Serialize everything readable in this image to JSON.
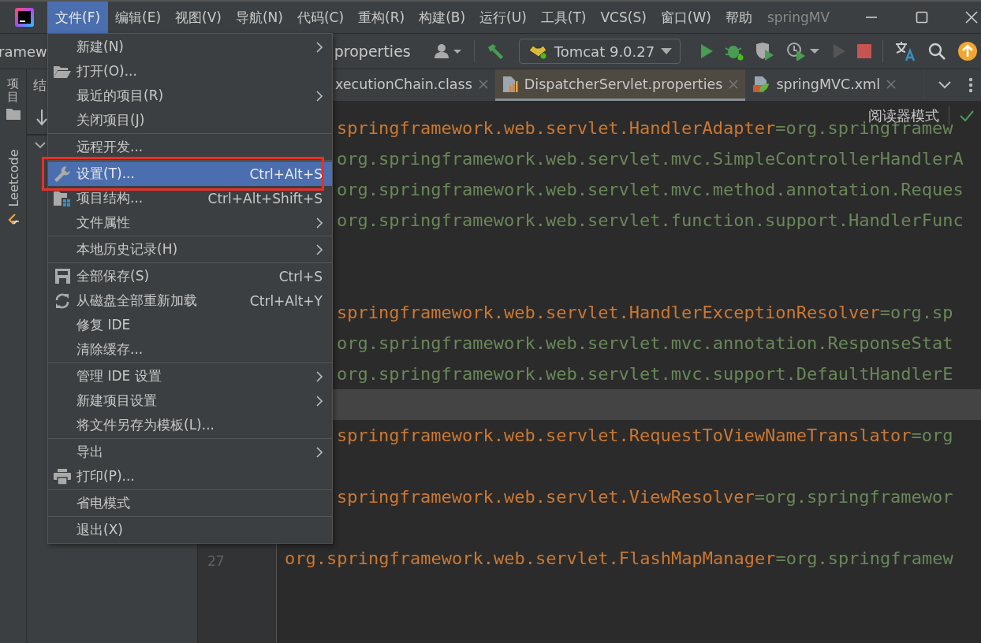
{
  "menu_bar": {
    "items": [
      {
        "label": "文件(F)",
        "selected": true
      },
      {
        "label": "编辑(E)",
        "selected": false
      },
      {
        "label": "视图(V)",
        "selected": false
      },
      {
        "label": "导航(N)",
        "selected": false
      },
      {
        "label": "代码(C)",
        "selected": false
      },
      {
        "label": "重构(R)",
        "selected": false
      },
      {
        "label": "构建(B)",
        "selected": false
      },
      {
        "label": "运行(U)",
        "selected": false
      },
      {
        "label": "工具(T)",
        "selected": false
      },
      {
        "label": "VCS(S)",
        "selected": false
      },
      {
        "label": "窗口(W)",
        "selected": false
      },
      {
        "label": "帮助",
        "selected": false
      }
    ],
    "window_title": "springMV"
  },
  "toolbar": {
    "breadcrumb": "ramew",
    "file": "properties",
    "run_config": "Tomcat 9.0.27"
  },
  "side_tabs": [
    {
      "label": "项目",
      "kind": "stacked"
    },
    {
      "label": "Leetcode",
      "kind": "rotated"
    }
  ],
  "project_panel": {
    "title": "结"
  },
  "editor_tabs": [
    {
      "label": "xecutionChain.class",
      "kind": "class",
      "selected": false
    },
    {
      "label": "DispatcherServlet.properties",
      "kind": "properties",
      "selected": true
    },
    {
      "label": "springMVC.xml",
      "kind": "xml",
      "selected": false
    }
  ],
  "editor": {
    "reader_mode": "阅读器模式",
    "lines": [
      {
        "kind": "entry",
        "key": "springframework.web.servlet.HandlerAdapter",
        "value": "=org.springframew",
        "current": false
      },
      {
        "kind": "continuation",
        "value": "org.springframework.web.servlet.mvc.SimpleControllerHandlerA",
        "current": false
      },
      {
        "kind": "continuation",
        "value": "org.springframework.web.servlet.mvc.method.annotation.Reques",
        "current": false
      },
      {
        "kind": "continuation",
        "value": "org.springframework.web.servlet.function.support.HandlerFunc",
        "current": false
      },
      {
        "kind": "blank",
        "current": false
      },
      {
        "kind": "blank",
        "current": false
      },
      {
        "kind": "entry",
        "key": "springframework.web.servlet.HandlerExceptionResolver",
        "value": "=org.sp",
        "current": false
      },
      {
        "kind": "continuation",
        "value": "org.springframework.web.servlet.mvc.annotation.ResponseStat",
        "current": false
      },
      {
        "kind": "continuation",
        "value": "org.springframework.web.servlet.mvc.support.DefaultHandlerE",
        "current": false
      },
      {
        "kind": "blank",
        "current": true
      },
      {
        "kind": "entry",
        "key": "springframework.web.servlet.RequestToViewNameTranslator",
        "value": "=org",
        "current": false
      },
      {
        "kind": "blank",
        "current": false
      },
      {
        "kind": "entry",
        "key": "springframework.web.servlet.ViewResolver",
        "value": "=org.springframewor",
        "current": false
      },
      {
        "kind": "blank",
        "current": false
      },
      {
        "kind": "entry",
        "key": "org.springframework.web.servlet.FlashMapManager",
        "value": "=org.springframew",
        "current": false,
        "line_number": "27"
      }
    ]
  },
  "file_menu": {
    "groups": [
      [
        {
          "label": "新建(N)",
          "kind": "plain",
          "submenu": true,
          "selected": false,
          "annotated": false
        },
        {
          "label": "打开(O)...",
          "kind": "folder",
          "submenu": false,
          "selected": false,
          "annotated": false
        },
        {
          "label": "最近的项目(R)",
          "kind": "plain",
          "submenu": true,
          "selected": false,
          "annotated": false
        },
        {
          "label": "关闭项目(J)",
          "kind": "plain",
          "submenu": false,
          "selected": false,
          "annotated": false
        }
      ],
      [
        {
          "label": "远程开发...",
          "kind": "plain",
          "submenu": false,
          "selected": false,
          "annotated": false
        }
      ],
      [
        {
          "label": "设置(T)...",
          "kind": "wrench",
          "shortcut": "Ctrl+Alt+S",
          "submenu": false,
          "selected": true,
          "annotated": true
        },
        {
          "label": "项目结构...",
          "kind": "structure",
          "shortcut": "Ctrl+Alt+Shift+S",
          "submenu": false,
          "selected": false,
          "annotated": false
        },
        {
          "label": "文件属性",
          "kind": "plain",
          "submenu": true,
          "selected": false,
          "annotated": false
        }
      ],
      [
        {
          "label": "本地历史记录(H)",
          "kind": "plain",
          "submenu": true,
          "selected": false,
          "annotated": false
        }
      ],
      [
        {
          "label": "全部保存(S)",
          "kind": "save",
          "shortcut": "Ctrl+S",
          "submenu": false,
          "selected": false,
          "annotated": false
        },
        {
          "label": "从磁盘全部重新加载",
          "kind": "reload",
          "shortcut": "Ctrl+Alt+Y",
          "submenu": false,
          "selected": false,
          "annotated": false
        },
        {
          "label": "修复 IDE",
          "kind": "plain",
          "submenu": false,
          "selected": false,
          "annotated": false
        },
        {
          "label": "清除缓存...",
          "kind": "plain",
          "submenu": false,
          "selected": false,
          "annotated": false
        }
      ],
      [
        {
          "label": "管理 IDE 设置",
          "kind": "plain",
          "submenu": true,
          "selected": false,
          "annotated": false
        },
        {
          "label": "新建项目设置",
          "kind": "plain",
          "submenu": true,
          "selected": false,
          "annotated": false
        },
        {
          "label": "将文件另存为模板(L)...",
          "kind": "plain",
          "submenu": false,
          "selected": false,
          "annotated": false
        }
      ],
      [
        {
          "label": "导出",
          "kind": "plain",
          "submenu": true,
          "selected": false,
          "annotated": false
        },
        {
          "label": "打印(P)...",
          "kind": "printer",
          "submenu": false,
          "selected": false,
          "annotated": false
        }
      ],
      [
        {
          "label": "省电模式",
          "kind": "plain",
          "submenu": false,
          "selected": false,
          "annotated": false
        }
      ],
      [
        {
          "label": "退出(X)",
          "kind": "plain",
          "submenu": false,
          "selected": false,
          "annotated": false
        }
      ]
    ]
  }
}
